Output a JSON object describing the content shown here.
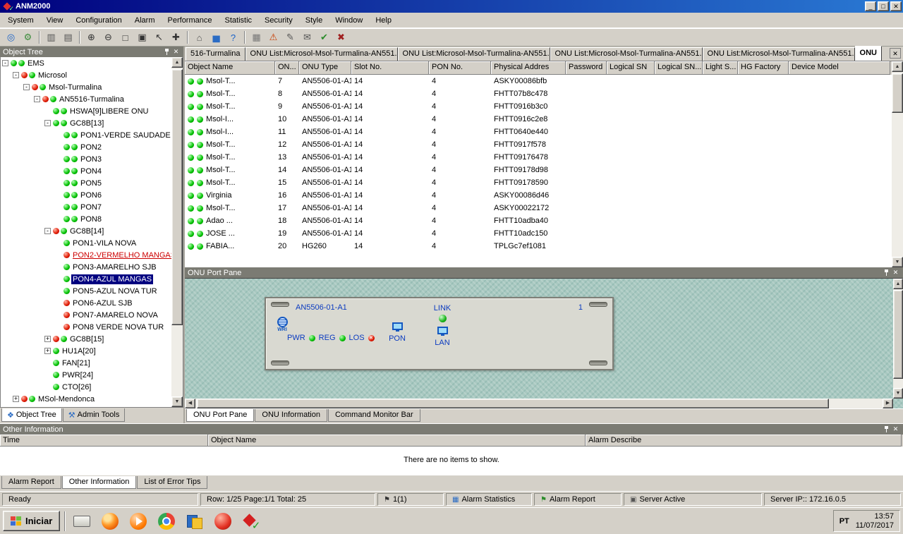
{
  "window": {
    "title": "ANM2000"
  },
  "icons": {
    "minimize": "_",
    "maximize": "□",
    "close": "✕",
    "scroll_up": "▲",
    "scroll_down": "▼",
    "scroll_left": "◀",
    "scroll_right": "▶",
    "tab_close": "✕"
  },
  "menubar": {
    "items": [
      "System",
      "View",
      "Configuration",
      "Alarm",
      "Performance",
      "Statistic",
      "Security",
      "Style",
      "Window",
      "Help"
    ]
  },
  "toolbar": {
    "icons": [
      {
        "name": "ems-view-icon",
        "glyph": "◎",
        "color": "#1a62c8"
      },
      {
        "name": "config-view-icon",
        "glyph": "⚙",
        "color": "#3c8c3c"
      },
      {
        "separator": true
      },
      {
        "name": "save-icon",
        "glyph": "▥",
        "color": "#555555"
      },
      {
        "name": "print-icon",
        "glyph": "▤",
        "color": "#555555"
      },
      {
        "separator": true
      },
      {
        "name": "zoom-in-icon",
        "glyph": "⊕",
        "color": "#333333"
      },
      {
        "name": "zoom-out-icon",
        "glyph": "⊖",
        "color": "#333333"
      },
      {
        "name": "zoom-select-icon",
        "glyph": "□",
        "color": "#333333"
      },
      {
        "name": "fit-view-icon",
        "glyph": "▣",
        "color": "#333333"
      },
      {
        "name": "pointer-icon",
        "glyph": "↖",
        "color": "#333333"
      },
      {
        "name": "pan-icon",
        "glyph": "✚",
        "color": "#333333"
      },
      {
        "separator": true
      },
      {
        "name": "home-icon",
        "glyph": "⌂",
        "color": "#555555"
      },
      {
        "name": "chart-icon",
        "glyph": "▅",
        "color": "#2b6cc4"
      },
      {
        "name": "help-icon",
        "glyph": "?",
        "color": "#1a62c8"
      },
      {
        "separator": true
      },
      {
        "name": "device-panel-icon",
        "glyph": "▦",
        "color": "#777777"
      },
      {
        "name": "alarm-icon",
        "glyph": "⚠",
        "color": "#c83c00"
      },
      {
        "name": "edit-icon",
        "glyph": "✎",
        "color": "#555555"
      },
      {
        "name": "export-icon",
        "glyph": "✉",
        "color": "#555555"
      },
      {
        "name": "confirm-icon",
        "glyph": "✔",
        "color": "#2c8c2c"
      },
      {
        "name": "exit-icon",
        "glyph": "✖",
        "color": "#a02020"
      }
    ]
  },
  "object_tree": {
    "caption": "Object Tree",
    "nodes": [
      {
        "level": 0,
        "expander": "minus",
        "leds": [
          "green",
          "green"
        ],
        "label": "EMS"
      },
      {
        "level": 1,
        "expander": "minus",
        "leds": [
          "red",
          "green"
        ],
        "label": "Microsol"
      },
      {
        "level": 2,
        "expander": "minus",
        "leds": [
          "red",
          "green"
        ],
        "label": "Msol-Turmalina"
      },
      {
        "level": 3,
        "expander": "minus",
        "leds": [
          "red",
          "green"
        ],
        "label": "AN5516-Turmalina"
      },
      {
        "level": 4,
        "leds": [
          "green",
          "green"
        ],
        "label": "HSWA[9]LIBERE ONU"
      },
      {
        "level": 4,
        "expander": "minus",
        "leds": [
          "green",
          "green"
        ],
        "label": "GC8B[13]"
      },
      {
        "level": 5,
        "leds": [
          "green",
          "green"
        ],
        "label": "PON1-VERDE SAUDADE"
      },
      {
        "level": 5,
        "leds": [
          "green",
          "green"
        ],
        "label": "PON2"
      },
      {
        "level": 5,
        "leds": [
          "green",
          "green"
        ],
        "label": "PON3"
      },
      {
        "level": 5,
        "leds": [
          "green",
          "green"
        ],
        "label": "PON4"
      },
      {
        "level": 5,
        "leds": [
          "green",
          "green"
        ],
        "label": "PON5"
      },
      {
        "level": 5,
        "leds": [
          "green",
          "green"
        ],
        "label": "PON6"
      },
      {
        "level": 5,
        "leds": [
          "green",
          "green"
        ],
        "label": "PON7"
      },
      {
        "level": 5,
        "leds": [
          "green",
          "green"
        ],
        "label": "PON8"
      },
      {
        "level": 4,
        "expander": "minus",
        "leds": [
          "red",
          "green"
        ],
        "label": "GC8B[14]"
      },
      {
        "level": 5,
        "leds": [
          "green"
        ],
        "label": "PON1-VILA NOVA"
      },
      {
        "level": 5,
        "leds": [
          "red"
        ],
        "label": "PON2-VERMELHO MANGAS",
        "alarm": true
      },
      {
        "level": 5,
        "leds": [
          "green"
        ],
        "label": "PON3-AMARELHO SJB"
      },
      {
        "level": 5,
        "leds": [
          "green"
        ],
        "label": "PON4-AZUL MANGAS",
        "selected": true
      },
      {
        "level": 5,
        "leds": [
          "green"
        ],
        "label": "PON5-AZUL NOVA TUR"
      },
      {
        "level": 5,
        "leds": [
          "red"
        ],
        "label": "PON6-AZUL SJB"
      },
      {
        "level": 5,
        "leds": [
          "red"
        ],
        "label": "PON7-AMARELO NOVA"
      },
      {
        "level": 5,
        "leds": [
          "red"
        ],
        "label": "PON8 VERDE NOVA TUR"
      },
      {
        "level": 4,
        "expander": "plus",
        "leds": [
          "red",
          "green"
        ],
        "label": "GC8B[15]"
      },
      {
        "level": 4,
        "expander": "plus",
        "leds": [
          "green"
        ],
        "label": "HU1A[20]"
      },
      {
        "level": 4,
        "leds": [
          "green"
        ],
        "label": "FAN[21]"
      },
      {
        "level": 4,
        "leds": [
          "green"
        ],
        "label": "PWR[24]"
      },
      {
        "level": 4,
        "leds": [
          "green"
        ],
        "label": "CTO[26]"
      },
      {
        "level": 1,
        "expander": "plus",
        "leds": [
          "red",
          "green"
        ],
        "label": "MSol-Mendonca"
      }
    ],
    "tabs": [
      {
        "label": "Object Tree",
        "icon": "object-tree-tab-icon",
        "glyph": "❖",
        "active": true
      },
      {
        "label": "Admin Tools",
        "icon": "admin-tools-tab-icon",
        "glyph": "⚒",
        "active": false
      }
    ]
  },
  "doc_tabs": [
    {
      "label": "516-Turmalina"
    },
    {
      "label": "ONU List:Microsol-Msol-Turmalina-AN551..."
    },
    {
      "label": "ONU List:Microsol-Msol-Turmalina-AN551..."
    },
    {
      "label": "ONU List:Microsol-Msol-Turmalina-AN551..."
    },
    {
      "label": "ONU List:Microsol-Msol-Turmalina-AN551..."
    },
    {
      "label": "ONU",
      "active": true
    }
  ],
  "onu_table": {
    "columns": [
      "Object Name",
      "ON...",
      "ONU Type",
      "Slot No.",
      "PON No.",
      "Physical Addres",
      "Password",
      "Logical SN",
      "Logical SN...",
      "Light S...",
      "HG Factory",
      "Device  Model"
    ],
    "rows": [
      [
        "Msol-T...",
        "7",
        "AN5506-01-A1",
        "14",
        "4",
        "ASKY00086bfb"
      ],
      [
        "Msol-T...",
        "8",
        "AN5506-01-A1",
        "14",
        "4",
        "FHTT07b8c478"
      ],
      [
        "Msol-T...",
        "9",
        "AN5506-01-A1",
        "14",
        "4",
        "FHTT0916b3c0"
      ],
      [
        "Msol-I...",
        "10",
        "AN5506-01-A1",
        "14",
        "4",
        "FHTT0916c2e8"
      ],
      [
        "Msol-I...",
        "11",
        "AN5506-01-A1",
        "14",
        "4",
        "FHTT0640e440"
      ],
      [
        "Msol-T...",
        "12",
        "AN5506-01-A1",
        "14",
        "4",
        "FHTT0917f578"
      ],
      [
        "Msol-T...",
        "13",
        "AN5506-01-A1",
        "14",
        "4",
        "FHTT09176478"
      ],
      [
        "Msol-T...",
        "14",
        "AN5506-01-A1",
        "14",
        "4",
        "FHTT09178d98"
      ],
      [
        "Msol-T...",
        "15",
        "AN5506-01-A1",
        "14",
        "4",
        "FHTT09178590"
      ],
      [
        "Virginia",
        "16",
        "AN5506-01-A1",
        "14",
        "4",
        "ASKY00086d46"
      ],
      [
        "Msol-T...",
        "17",
        "AN5506-01-A1",
        "14",
        "4",
        "ASKY00022172"
      ],
      [
        "Adao ...",
        "18",
        "AN5506-01-A1",
        "14",
        "4",
        "FHTT10adba40"
      ],
      [
        "JOSE ...",
        "19",
        "AN5506-01-A1",
        "14",
        "4",
        "FHTT10adc150"
      ],
      [
        "FABIA...",
        "20",
        "HG260",
        "14",
        "4",
        "TPLGc7ef1081"
      ]
    ]
  },
  "port_pane": {
    "caption": "ONU Port Pane",
    "device": {
      "model": "AN5506-01-A1",
      "index": "1",
      "logo_text": "WRI",
      "pwr_label": "PWR",
      "reg_label": "REG",
      "los_label": "LOS",
      "pon_label": "PON",
      "link_label": "LINK",
      "lan_label": "LAN"
    },
    "tabs": [
      {
        "label": "ONU Port Pane",
        "active": true
      },
      {
        "label": "ONU Information"
      },
      {
        "label": "Command Monitor Bar"
      }
    ]
  },
  "other_information": {
    "caption": "Other Information",
    "columns": [
      "Time",
      "Object Name",
      "Alarm Describe"
    ],
    "empty_message": "There are no items to show.",
    "tabs": [
      {
        "label": "Alarm Report"
      },
      {
        "label": "Other Information",
        "active": true
      },
      {
        "label": "List of Error Tips"
      }
    ]
  },
  "statusbar": {
    "segments": [
      {
        "name": "status-ready",
        "text": "Ready"
      },
      {
        "name": "status-row-info",
        "text": "Row: 1/25   Page:1/1   Total: 25"
      },
      {
        "name": "status-alarm-count",
        "icon": "alarm-filter-icon",
        "glyph": "⚑",
        "icon_color": "#333333",
        "text": "1(1)"
      },
      {
        "name": "status-alarm-statistics",
        "icon": "alarm-statistics-icon",
        "glyph": "▦",
        "icon_color": "#2b6cc4",
        "text": "Alarm Statistics"
      },
      {
        "name": "status-alarm-report",
        "icon": "alarm-report-icon",
        "glyph": "⚑",
        "icon_color": "#2c8c2c",
        "text": "Alarm Report"
      },
      {
        "name": "status-server-active",
        "icon": "server-status-icon",
        "glyph": "▣",
        "icon_color": "#555555",
        "text": "Server Active"
      },
      {
        "name": "status-server-ip",
        "text": "Server IP:: 172.16.0.5"
      }
    ]
  },
  "taskbar": {
    "start_label": "Iniciar",
    "quick_icons": [
      "window-taskbar-icon",
      "firefox-icon",
      "media-player-icon",
      "chrome-icon",
      "documents-icon",
      "red-sphere-icon",
      "anm-taskbar-icon"
    ],
    "language": "PT",
    "time": "13:57",
    "date": "11/07/2017"
  }
}
